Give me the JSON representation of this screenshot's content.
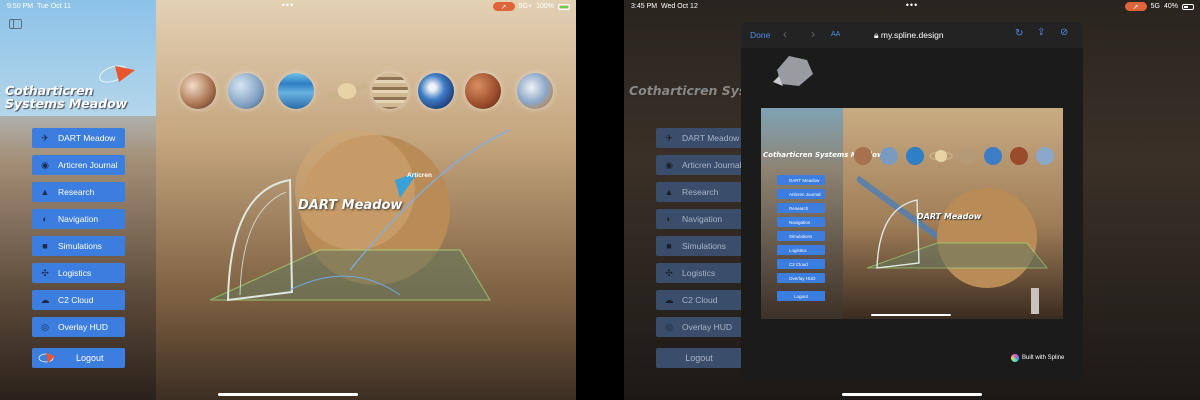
{
  "left": {
    "status": {
      "time": "9:50 PM",
      "date": "Tue Oct 11",
      "dots": "•••",
      "signal": "5G+",
      "battery": "100%"
    },
    "brand": {
      "title": "Cotharticren Systems Meadow"
    },
    "menu": [
      {
        "label": "DART Meadow",
        "icon": "spacecraft-icon"
      },
      {
        "label": "Articren Journal",
        "icon": "camera-icon"
      },
      {
        "label": "Research",
        "icon": "ship-icon"
      },
      {
        "label": "Navigation",
        "icon": "goggles-icon"
      },
      {
        "label": "Simulations",
        "icon": "shield-icon"
      },
      {
        "label": "Logistics",
        "icon": "drone-icon"
      },
      {
        "label": "C2 Cloud",
        "icon": "cloud-icon"
      },
      {
        "label": "Overlay HUD",
        "icon": "hud-icon"
      }
    ],
    "logout": {
      "label": "Logout"
    },
    "scene": {
      "title": "DART Meadow",
      "subtitle": "Articren"
    }
  },
  "right": {
    "status": {
      "time": "3:45 PM",
      "date": "Wed Oct 12",
      "dots": "•••",
      "signal": "5G",
      "battery": "40%"
    },
    "ghost_title": "Cotharticren Systems Meadow",
    "ghost_menu": [
      "DART Meadow",
      "Articren Journal",
      "Research",
      "Navigation",
      "Simulations",
      "Logistics",
      "C2 Cloud",
      "Overlay HUD"
    ],
    "ghost_logout": "Logout",
    "browser": {
      "done": "Done",
      "text_size": "AA",
      "url": "my.spline.design",
      "embed_title": "Cotharticren Systems Meadow",
      "embed_menu": [
        "DART Meadow",
        "Articren Journal",
        "Research",
        "Navigation",
        "Simulations",
        "Logistics",
        "C2 Cloud",
        "Overlay HUD"
      ],
      "embed_logout": "Logout",
      "embed_scene_title": "DART Meadow",
      "built_with": "Built with Spline"
    }
  },
  "colors": {
    "menu_button": "#3c7de0",
    "link_blue": "#4a8fe8",
    "status_pill": "#e0643a"
  }
}
